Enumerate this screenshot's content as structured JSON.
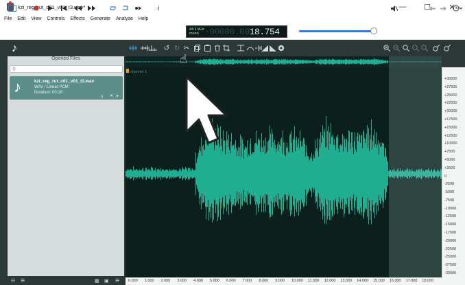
{
  "window": {
    "title": "kzi_reg_rut_c01_v01_t3.wav*",
    "minimize_glyph": "—",
    "maximize_glyph": "☐",
    "close_glyph": "✕"
  },
  "menu": [
    "File",
    "Edit",
    "View",
    "Controls",
    "Effects",
    "Generate",
    "Analyze",
    "Help"
  ],
  "toolbar": {
    "info_glyph": "i",
    "counter": {
      "rate": "44.1 kHz",
      "channels": "mono",
      "ghost": "-00000.00",
      "time": "18.754"
    },
    "volume_level": 0.94
  },
  "panel": {
    "heading": "Opened Files",
    "search_placeholder": "",
    "file": {
      "name": "kzi_reg_rut_c01_v01_t3.wav",
      "format": "WAV / Linear PCM",
      "duration": "Duration: 00:18"
    }
  },
  "track": {
    "label": "channel 1",
    "amplitude_ticks": [
      "+30000",
      "+27500",
      "+25000",
      "+22500",
      "+20000",
      "+17500",
      "+15000",
      "+12500",
      "+10000",
      "+7500",
      "+5000",
      "+2500",
      "0",
      "-2500",
      "-5000",
      "-7500",
      "-10000",
      "-12500",
      "-15000",
      "-17500",
      "-20000",
      "-22500",
      "-25000",
      "-27500",
      "-30000"
    ],
    "time_ticks": [
      "0.000",
      "1.000",
      "2.000",
      "3.000",
      "4.000",
      "5.000",
      "6.000",
      "7.000",
      "8.000",
      "9.000",
      "10.000",
      "11.000",
      "12.000",
      "13.000",
      "14.000",
      "15.000",
      "16.000",
      "17.000",
      "18.000"
    ],
    "selection_start_s": 15.3,
    "selection_end_s": 18.75
  },
  "colors": {
    "waveform": "#1fae92",
    "track_bg": "#0b1f1d",
    "accent_blue": "#3aa0e8",
    "record": "#c8302c"
  }
}
